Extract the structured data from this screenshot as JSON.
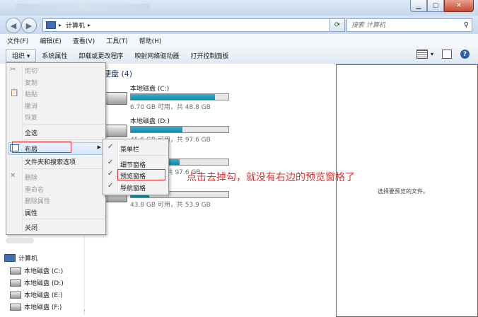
{
  "window": {
    "buttons": {
      "minimize": "▁",
      "maximize": "▢",
      "close": "✕"
    }
  },
  "address": {
    "crumb": "计算机",
    "search_placeholder": "搜索 计算机"
  },
  "menubar": [
    "文件(F)",
    "编辑(E)",
    "查看(V)",
    "工具(T)",
    "帮助(H)"
  ],
  "toolbar": {
    "organize": "组织 ▾",
    "items": [
      "系统属性",
      "卸载或更改程序",
      "映射网络驱动器",
      "打开控制面板"
    ]
  },
  "main": {
    "section_title": "硬盘 (4)",
    "drives": [
      {
        "name": "本地磁盘 (C:)",
        "info": "6.70 GB 可用，共 48.8 GB",
        "used_fraction": 0.86
      },
      {
        "name": "本地磁盘 (D:)",
        "info": "45.6 GB 可用，共 97.6 GB",
        "used_fraction": 0.53
      },
      {
        "name": "",
        "info": "1 GB 可用，共 97.6 GB",
        "used_fraction": 0.5
      },
      {
        "name": "",
        "info": "43.8 GB 可用，共 53.9 GB",
        "used_fraction": 0.19
      }
    ]
  },
  "preview": {
    "text": "选择要预览的文件。"
  },
  "annotation": "点击去掉勾，就没有右边的预览窗格了",
  "navpane": {
    "computer": "计算机",
    "drives": [
      "本地磁盘 (C:)",
      "本地磁盘 (D:)",
      "本地磁盘 (E:)",
      "本地磁盘 (F:)"
    ]
  },
  "organize_menu": {
    "cut": "剪切",
    "copy": "复制",
    "paste": "粘贴",
    "undo": "撤消",
    "redo": "恢复",
    "select_all": "全选",
    "layout": "布局",
    "folder_options": "文件夹和搜索选项",
    "delete": "删除",
    "rename": "重命名",
    "remove_properties": "删除属性",
    "properties": "属性",
    "close": "关闭"
  },
  "layout_submenu": {
    "menu_bar": "菜单栏",
    "details_pane": "细节窗格",
    "preview_pane": "预览窗格",
    "navigation_pane": "导航窗格"
  }
}
